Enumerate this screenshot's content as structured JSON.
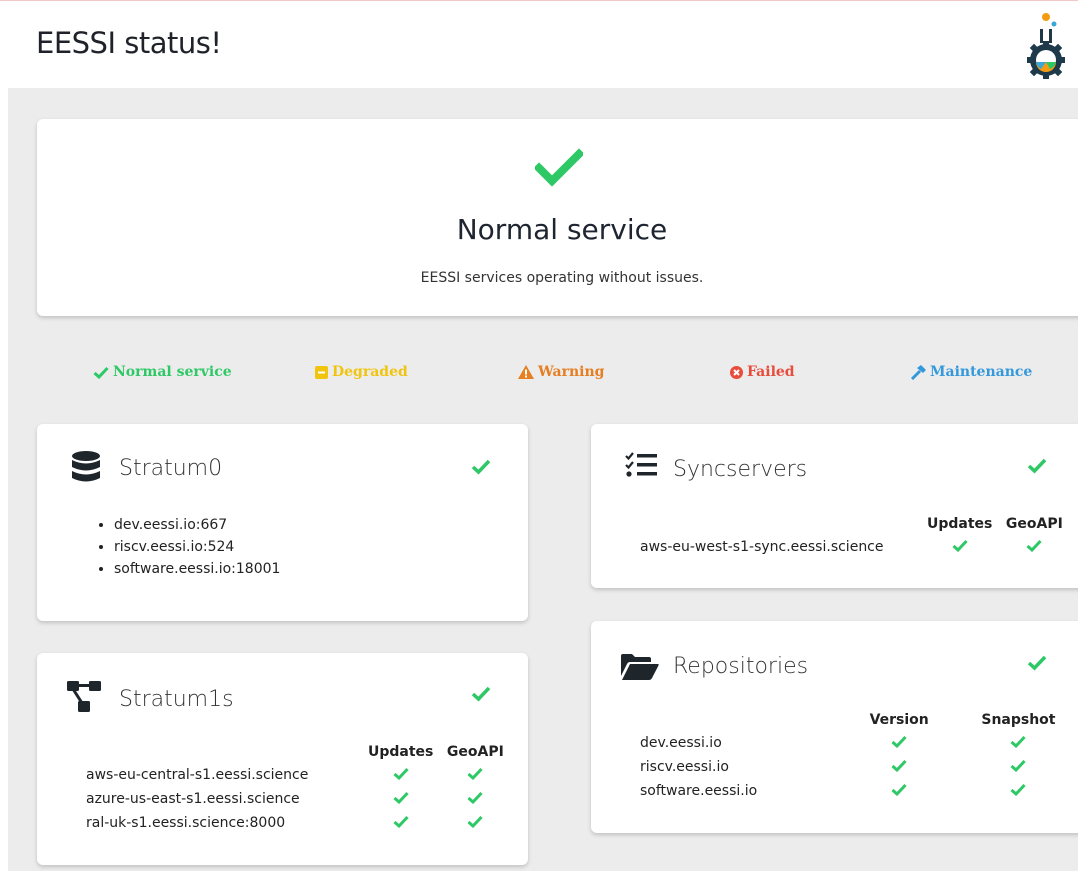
{
  "header": {
    "title": "EESSI status!"
  },
  "colors": {
    "green": "#2ec866",
    "yellow": "#f1c40f",
    "orange": "#e67e22",
    "red": "#e74c3c",
    "blue": "#3498db"
  },
  "overall": {
    "title": "Normal service",
    "description": "EESSI services operating without issues.",
    "icon": "check-icon"
  },
  "legend": {
    "normal": "Normal service",
    "degraded": "Degraded",
    "warning": "Warning",
    "failed": "Failed",
    "maintenance": "Maintenance"
  },
  "stratum0": {
    "title": "Stratum0",
    "icon": "database-icon",
    "items": [
      "dev.eessi.io:667",
      "riscv.eessi.io:524",
      "software.eessi.io:18001"
    ]
  },
  "stratum1s": {
    "title": "Stratum1s",
    "icon": "network-icon",
    "columns": [
      "Updates",
      "GeoAPI"
    ],
    "rows": [
      {
        "name": "aws-eu-central-s1.eessi.science"
      },
      {
        "name": "azure-us-east-s1.eessi.science"
      },
      {
        "name": "ral-uk-s1.eessi.science:8000"
      }
    ]
  },
  "syncservers": {
    "title": "Syncservers",
    "icon": "list-check-icon",
    "columns": [
      "Updates",
      "GeoAPI"
    ],
    "rows": [
      {
        "name": "aws-eu-west-s1-sync.eessi.science"
      }
    ]
  },
  "repositories": {
    "title": "Repositories",
    "icon": "folder-open-icon",
    "columns": [
      "Version",
      "Snapshot"
    ],
    "rows": [
      {
        "name": "dev.eessi.io"
      },
      {
        "name": "riscv.eessi.io"
      },
      {
        "name": "software.eessi.io"
      }
    ]
  }
}
